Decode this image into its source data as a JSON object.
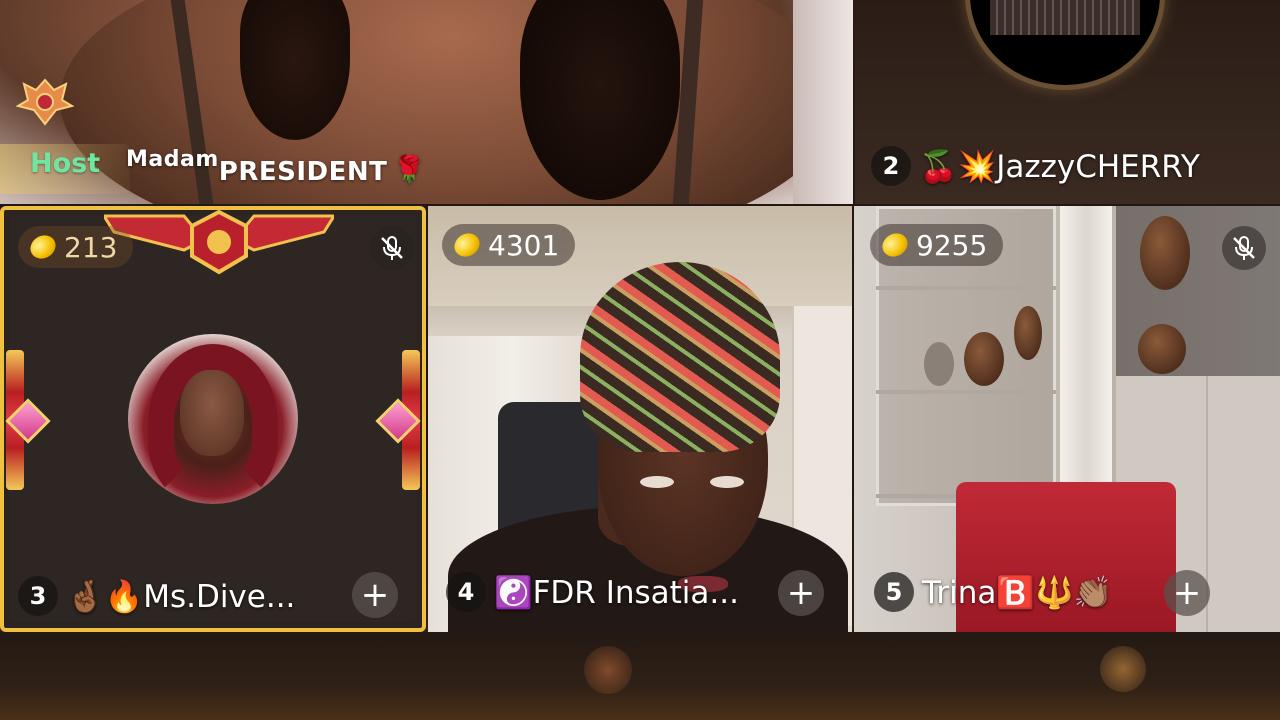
{
  "host": {
    "label": "Host",
    "name_part1": "Madam",
    "name_part2": "PRESIDENT",
    "emoji": "🌹"
  },
  "seats": [
    {
      "number": "2",
      "name": "🍒💥JazzyCHERRY"
    },
    {
      "number": "3",
      "name": "🤞🏾🔥Ms.Dive...",
      "coins": "213",
      "muted": true
    },
    {
      "number": "4",
      "name": "☯️FDR Insatia...",
      "coins": "4301"
    },
    {
      "number": "5",
      "name": "Trina🅱️🔱👏🏽",
      "coins": "9255",
      "muted": true
    }
  ],
  "icons": {
    "coin": "coin-icon",
    "mute": "mic-off-icon",
    "add": "plus-icon",
    "crest": "rank-crest-icon"
  },
  "colors": {
    "host_label": "#6fe6a0",
    "frame_gold": "#f0c040",
    "coin_gold": "#f5c000"
  },
  "plus_symbol": "+"
}
